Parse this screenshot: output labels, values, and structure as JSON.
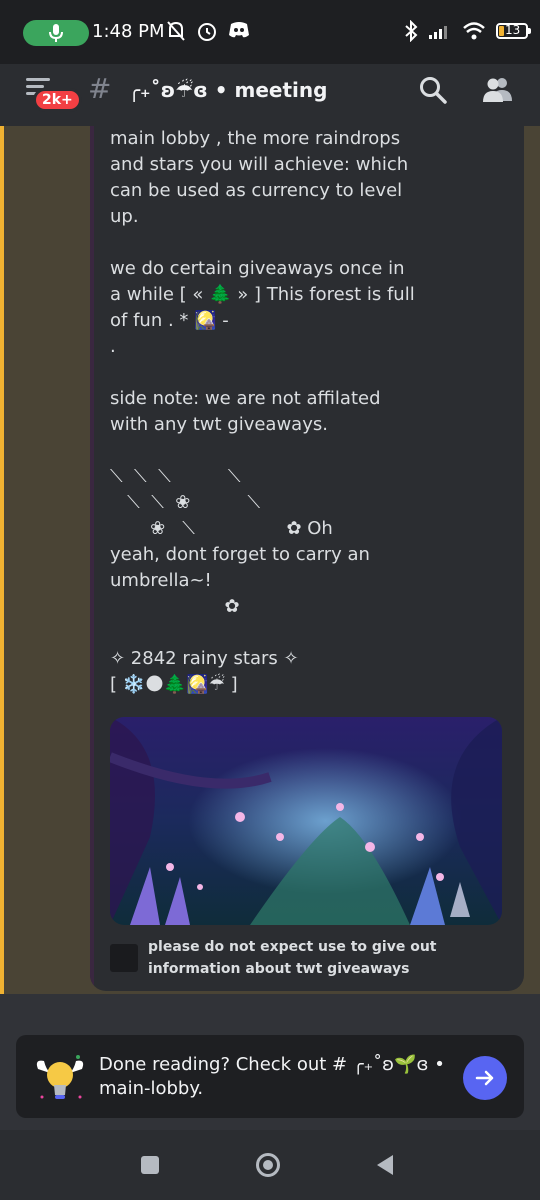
{
  "status_bar": {
    "time": "1:48 PM",
    "battery": "13",
    "mic_active_color": "#3ba55d",
    "icons": [
      "mic-icon",
      "mute-bell-icon",
      "alarm-icon",
      "discord-icon",
      "bluetooth-icon",
      "signal-icon",
      "wifi-icon",
      "battery-icon"
    ]
  },
  "header": {
    "badge": "2k+",
    "channel_hash": "#",
    "channel_name": "╭₊˚ʚ☔ɞ • meeting"
  },
  "message": {
    "text": "main lobby , the more raindrops\nand stars you will achieve: which\ncan be used as currency to level\nup.\n\nwe do certain giveaways once in\na while [ « 🌲 » ] This forest is full\nof fun . * 🎑 -\n.\n\nside note: we are not affilated\nwith any twt giveaways.\n\n⟍  ⟍  ⟍          ⟍\n   ⟍  ⟍  ❀          ⟍\n       ❀   ⟍                ✿ Oh\nyeah, dont forget to carry an\numbrella~!\n                    ✿\n\n✧ 2842 rainy stars ✧\n[ ❄️🌑🌲🎑☔ ]",
    "embed_footer": "please do not expect use to give out information about twt giveaways",
    "accent_color": "#f0b232"
  },
  "next_channel": {
    "text": "Done reading? Check out # ╭₊˚ʚ🌱ɞ • main-lobby.",
    "button_color": "#5865f2"
  },
  "nav": {
    "icons": [
      "recents-icon",
      "home-icon",
      "back-icon"
    ]
  }
}
